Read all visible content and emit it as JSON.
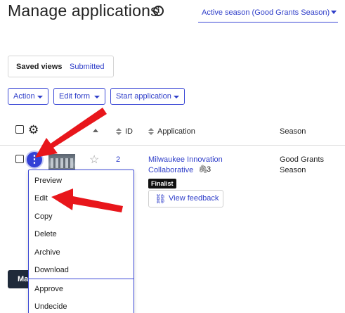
{
  "page": {
    "title": "Manage applications",
    "info_icon": "info-icon",
    "season_selector": "Active season (Good Grants Season)"
  },
  "views": {
    "saved": "Saved views",
    "submitted": "Submitted"
  },
  "toolbar": {
    "action": "Action",
    "edit_form": "Edit form",
    "start_application": "Start application"
  },
  "table": {
    "headers": {
      "id": "ID",
      "application": "Application",
      "season": "Season"
    },
    "rows": [
      {
        "id": "2",
        "application": "Milwaukee Innovation Collaborative",
        "attachments": "3",
        "season": "Good Grants Season",
        "badge": "Finalist",
        "feedback_label": "View feedback"
      }
    ]
  },
  "row_menu": {
    "items": [
      "Preview",
      "Edit",
      "Copy",
      "Delete",
      "Archive",
      "Download",
      "Approve",
      "Undecide"
    ]
  },
  "bottom_button": "Ma",
  "colors": {
    "accent": "#3341d6",
    "annotation_arrow": "#e8161b",
    "badge_bg": "#111111"
  }
}
